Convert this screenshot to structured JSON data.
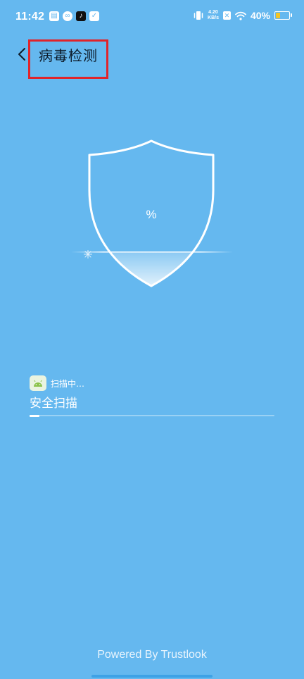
{
  "status_bar": {
    "time": "11:42",
    "net_speed_value": "4.20",
    "net_speed_unit": "KB/s",
    "battery_percent": "40%",
    "battery_level": 0.4,
    "battery_color": "#f3c524",
    "left_icons": [
      "message-icon",
      "bilibili-icon",
      "tiktok-icon",
      "mail-icon"
    ]
  },
  "header": {
    "title": "病毒检测",
    "highlight_color": "#e0242b"
  },
  "shield": {
    "percent_label": "%"
  },
  "scan": {
    "status_text": "扫描中…",
    "title": "安全扫描",
    "progress": 0.04
  },
  "footer": {
    "powered_by": "Powered By Trustlook"
  },
  "colors": {
    "background": "#65b8ef",
    "accent": "#ffffff"
  }
}
